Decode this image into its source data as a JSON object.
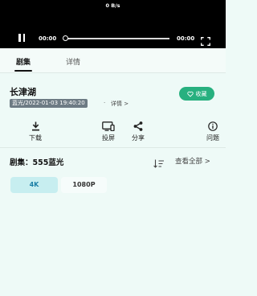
{
  "player": {
    "net_speed": "0 B/s",
    "current_time": "00:00",
    "total_time": "00:00",
    "progress": 0,
    "icons": [
      "pause-icon",
      "fullscreen-icon"
    ]
  },
  "tabs": [
    {
      "label": "剧集",
      "active": true
    },
    {
      "label": "详情",
      "active": false
    }
  ],
  "title": "长津湖",
  "favorite_label": "收藏",
  "meta": {
    "tag": "蓝光/2022-01-03 19:40:20",
    "separator": "·",
    "details_label": "详情 >"
  },
  "actions": [
    {
      "label": "下载",
      "icon": "download-icon"
    },
    {
      "label": "投屏",
      "icon": "cast-icon"
    },
    {
      "label": "分享",
      "icon": "share-icon"
    },
    {
      "label": "问题",
      "icon": "info-icon"
    }
  ],
  "episodes": {
    "title": "剧集：555蓝光",
    "view_all": "查看全部 >"
  },
  "qualities": [
    {
      "label": "4K",
      "selected": true
    },
    {
      "label": "1080P",
      "selected": false
    }
  ],
  "colors": {
    "accent": "#27b07f",
    "page_bg": "#eefaf7",
    "chip_selected_bg": "#c7eef0",
    "chip_selected_text": "#1b7fa6",
    "meta_tag_bg": "#6d7b84"
  }
}
